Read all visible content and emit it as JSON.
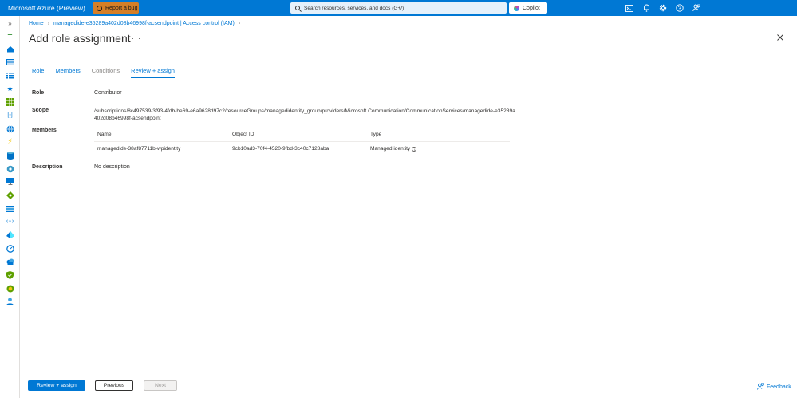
{
  "topbar": {
    "brand": "Microsoft Azure (Preview)",
    "report_bug": "Report a bug",
    "search_placeholder": "Search resources, services, and docs (G+/)",
    "copilot": "Copilot"
  },
  "breadcrumb": {
    "home": "Home",
    "resource": "managedide-e35289a402d08b46998f-acsendpoint | Access control (IAM)"
  },
  "page": {
    "title": "Add role assignment",
    "more": "···"
  },
  "tabs": [
    {
      "label": "Role",
      "state": "link"
    },
    {
      "label": "Members",
      "state": "link"
    },
    {
      "label": "Conditions",
      "state": "disabled"
    },
    {
      "label": "Review + assign",
      "state": "active"
    }
  ],
  "details": {
    "role_label": "Role",
    "role_value": "Contributor",
    "scope_label": "Scope",
    "scope_value": "/subscriptions/8c497539-3f93-4fdb-be69-e6a9628d97c2/resourceGroups/managedidentity_group/providers/Microsoft.Communication/CommunicationServices/managedide-e35289a402d08b46998f-acsendpoint",
    "members_label": "Members",
    "description_label": "Description",
    "description_value": "No description"
  },
  "members_table": {
    "headers": [
      "Name",
      "Object ID",
      "Type"
    ],
    "rows": [
      [
        "managedide-38af87711b-wpidentity",
        "9cb10ad3-70f4-4520-9fbd-3c40c7128aba",
        "Managed identity"
      ]
    ]
  },
  "footer": {
    "review_assign": "Review + assign",
    "previous": "Previous",
    "next": "Next",
    "feedback": "Feedback"
  },
  "colors": {
    "accent": "#0078d4",
    "bug_button": "#d57f27"
  }
}
